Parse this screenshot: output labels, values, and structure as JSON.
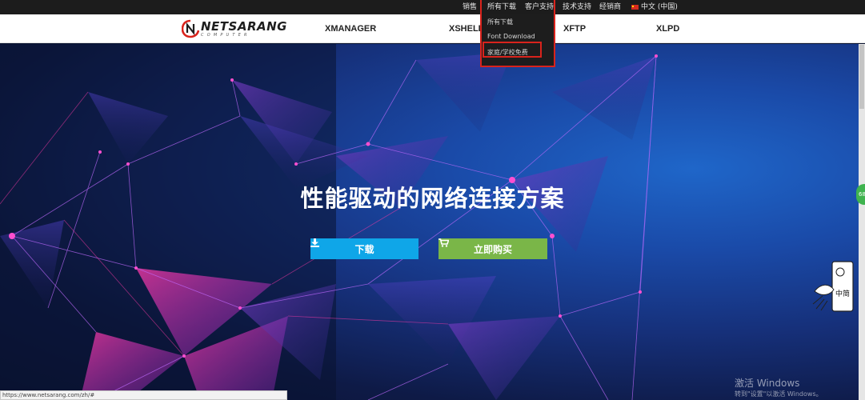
{
  "topbar": {
    "items": [
      "销售",
      "所有下载",
      "客户支持",
      "技术支持",
      "经销商"
    ],
    "language": "中文 (中国)"
  },
  "logo": {
    "name": "NETSARANG",
    "subtitle": "COMPUTER"
  },
  "mainnav": {
    "items": [
      "XMANAGER",
      "XSHELL",
      "XFTP",
      "XLPD"
    ]
  },
  "dropdown": {
    "items": [
      "所有下载",
      "Font Download",
      "家庭/学校免费"
    ],
    "highlighted_index": 2,
    "highlight_color": "#d9231c"
  },
  "hero": {
    "title": "性能驱动的网络连接方案",
    "download_button": "下载",
    "buy_button": "立即购买",
    "download_color": "#0fa6e8",
    "buy_color": "#7ab648"
  },
  "side_chip": "68",
  "ime_label": "中简",
  "status_bar": {
    "url": "https://www.netsarang.com/zh/#"
  },
  "windows_activation": {
    "line1": "激活 Windows",
    "line2": "转到\"设置\"以激活 Windows。"
  },
  "icons": [
    "download-icon",
    "cart-icon",
    "flag-icon",
    "logo-mark-icon",
    "ime-icon"
  ]
}
